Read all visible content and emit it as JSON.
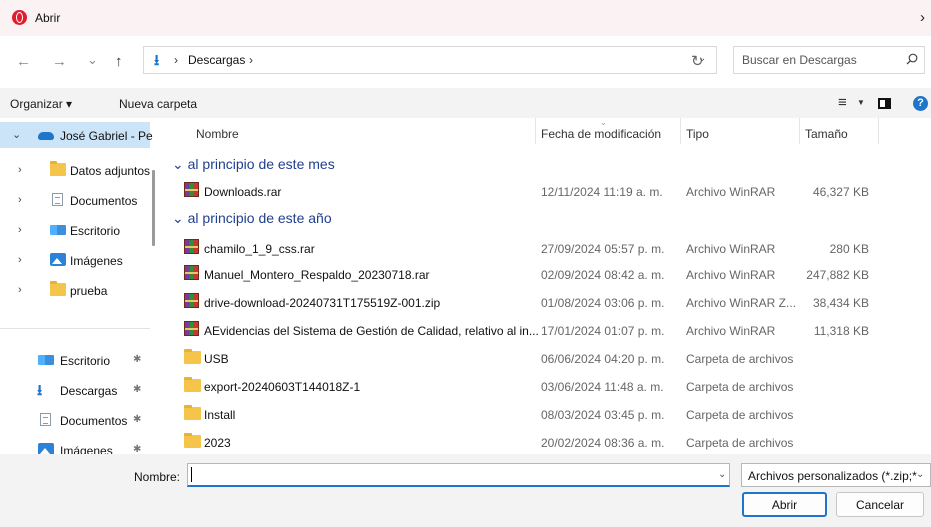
{
  "title": {
    "text": "Abrir",
    "chevron": "›"
  },
  "nav": {
    "back_glyph": "←",
    "forward_glyph": "→",
    "recent_glyph": "⌄",
    "up_glyph": "↑",
    "address": {
      "icon": "download-icon",
      "sep1": "›",
      "location": "Descargas",
      "sep2": "›",
      "drop": "⌄"
    },
    "refresh_glyph": "↻",
    "search": {
      "placeholder": "Buscar en Descargas"
    }
  },
  "toolbar": {
    "organize": "Organizar ▾",
    "new_folder": "Nueva carpeta",
    "view_glyph": "≡",
    "view_drop": "▼",
    "help": "?"
  },
  "sidebar": {
    "account": {
      "label": "José Gabriel - Pe",
      "chevron": "⌄"
    },
    "tree": [
      {
        "label": "Datos adjuntos",
        "icon": "folder-icon",
        "chevron": "›"
      },
      {
        "label": "Documentos",
        "icon": "document-icon",
        "chevron": "›"
      },
      {
        "label": "Escritorio",
        "icon": "desktop-icon",
        "chevron": "›"
      },
      {
        "label": "Imágenes",
        "icon": "image-icon",
        "chevron": "›"
      },
      {
        "label": "prueba",
        "icon": "folder-icon",
        "chevron": "›"
      }
    ],
    "quick": [
      {
        "label": "Escritorio",
        "icon": "desktop-icon",
        "pin": "✱"
      },
      {
        "label": "Descargas",
        "icon": "download-icon",
        "pin": "✱"
      },
      {
        "label": "Documentos",
        "icon": "document-icon",
        "pin": "✱"
      },
      {
        "label": "Imágenes",
        "icon": "image-icon",
        "pin": "✱"
      }
    ]
  },
  "columns": {
    "name": "Nombre",
    "date": "Fecha de modificación",
    "type": "Tipo",
    "size": "Tamaño"
  },
  "groups": [
    {
      "label": "al principio de este mes",
      "chevron": "⌄"
    },
    {
      "label": "al principio de este año",
      "chevron": "⌄"
    }
  ],
  "files": [
    {
      "name": "Downloads.rar",
      "date": "12/11/2024 11:19 a. m.",
      "type": "Archivo WinRAR",
      "size": "46,327 KB",
      "icon": "winrar-icon"
    },
    {
      "name": "chamilo_1_9_css.rar",
      "date": "27/09/2024 05:57 p. m.",
      "type": "Archivo WinRAR",
      "size": "280 KB",
      "icon": "winrar-icon"
    },
    {
      "name": "Manuel_Montero_Respaldo_20230718.rar",
      "date": "02/09/2024 08:42 a. m.",
      "type": "Archivo WinRAR",
      "size": "247,882 KB",
      "icon": "winrar-icon"
    },
    {
      "name": "drive-download-20240731T175519Z-001.zip",
      "date": "01/08/2024 03:06 p. m.",
      "type": "Archivo WinRAR Z...",
      "size": "38,434 KB",
      "icon": "winrar-icon"
    },
    {
      "name": "AEvidencias del Sistema de Gestión de Calidad, relativo al in...",
      "date": "17/01/2024 01:07 p. m.",
      "type": "Archivo WinRAR",
      "size": "11,318 KB",
      "icon": "winrar-icon"
    },
    {
      "name": "USB",
      "date": "06/06/2024 04:20 p. m.",
      "type": "Carpeta de archivos",
      "size": "",
      "icon": "folder-icon"
    },
    {
      "name": "export-20240603T144018Z-1",
      "date": "03/06/2024 11:48 a. m.",
      "type": "Carpeta de archivos",
      "size": "",
      "icon": "folder-icon"
    },
    {
      "name": "Install",
      "date": "08/03/2024 03:45 p. m.",
      "type": "Carpeta de archivos",
      "size": "",
      "icon": "folder-icon"
    },
    {
      "name": "2023",
      "date": "20/02/2024 08:36 a. m.",
      "type": "Carpeta de archivos",
      "size": "",
      "icon": "folder-icon"
    }
  ],
  "footer": {
    "name_label": "Nombre:",
    "name_value": "",
    "type_filter": "Archivos personalizados (*.zip;*",
    "drop": "⌄",
    "open_button": "Abrir",
    "cancel_button": "Cancelar"
  },
  "colors": {
    "accent": "#1f75c9",
    "group_heading": "#1f3f8f",
    "titlebar": "#fbf2f3",
    "selection": "#cce4f7"
  }
}
